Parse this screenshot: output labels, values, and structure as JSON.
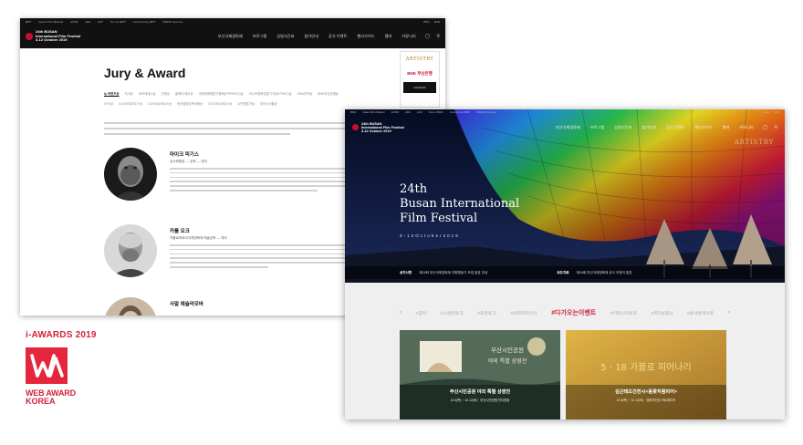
{
  "award": {
    "title": "i-AWARDS 2019",
    "name": "WEB AWARD",
    "country": "KOREA"
  },
  "site": {
    "logo_line1": "24th BUSAN",
    "logo_line2": "International Film Festival",
    "logo_line3": "3-12 October 2019",
    "util_links": [
      "BIFF",
      "Asian Film Market",
      "ACFM",
      "APA",
      "ACF",
      "Forum BIFF",
      "Community BIFF",
      "FRESH Service"
    ],
    "lang_links": [
      "ENG",
      "KOR"
    ],
    "menu": [
      "부산국제영화제",
      "프로그램",
      "상영시간표",
      "참가안내",
      "공식 이벤트",
      "행사가이드",
      "멤버",
      "커뮤니티"
    ],
    "user_icon": "user-icon",
    "search_icon": "search-icon"
  },
  "shot1": {
    "page_title": "Jury & Award",
    "tabs": [
      "뉴 커런츠상",
      "지석상",
      "비프메세나상",
      "선재상",
      "올해의 배우상",
      "국제영화평론가협회(FIPRESCI)상",
      "아시아영화진흥기구(NETPAC)상",
      "KNN관객상",
      "BNK부산은행상",
      "KTH상",
      "CGV아트하우스상",
      "CGV아트하우스상",
      "한국영화감독조합상",
      "CGV아트하우스상",
      "시민평론가상",
      "부산시네필상"
    ],
    "active_tab": 0,
    "jury": [
      {
        "name": "마이크 피기스",
        "role": "심사위원장 — 감독 — 영국"
      },
      {
        "name": "카를 오크",
        "role": "카를로비바리국제영화제 예술감독 — 체코"
      },
      {
        "name": "사말 예슬라모바",
        "role": ""
      }
    ],
    "ad": {
      "brand": "ARTISTRY",
      "bank": "BNK 부산은행",
      "car": "GENESIS"
    }
  },
  "shot2": {
    "brand": "ARTISTRY",
    "fest_title_line1": "24th",
    "fest_title_line2": "Busan International",
    "fest_title_line3": "Film Festival",
    "fest_date": "3 - 1 2  O c t o b e r  2 0 1 9",
    "ticker": [
      {
        "tag": "공지사항",
        "text": "제24회 부산국제영화제 자원활동가 모집 발표 안내"
      },
      {
        "tag": "보도자료",
        "text": "제24회 부산국제영화제 공식 초청작 발표"
      }
    ],
    "tabs_prev": "‹",
    "tabs": [
      "#갈라",
      "#스페셜토크",
      "#오픈토크",
      "#야외무대인사",
      "#다가오는이벤트",
      "#커뮤니티비프",
      "#파티&행사",
      "#동네방네비프"
    ],
    "tabs_next": "›",
    "active_tab": 4,
    "cards": [
      {
        "title": "부산시민공원 야외 특별 상영전",
        "sub": "10.3(목) ~ 10.12(토) · 부산시민공원 잔디광장"
      },
      {
        "title": "김근태조건전시<동꽃처럼피어>",
        "sub": "10.3(목) ~ 10.12(토) · 영화의전당 아트레이어"
      }
    ],
    "card1_art_text1": "부산시민공원",
    "card1_art_text2": "야외 특별 상영전",
    "card2_art_text": "5 · 18 가볼로 피어나리"
  },
  "colors": {
    "accent_red": "#d0243c",
    "nav_dark": "#111111",
    "gold": "#d9b77a"
  }
}
